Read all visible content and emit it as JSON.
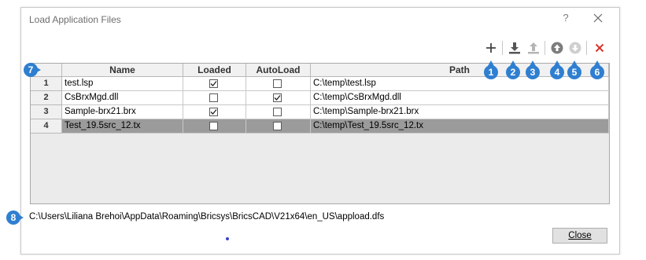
{
  "window": {
    "title": "Load Application Files",
    "help_label": "?"
  },
  "toolbar": {
    "icons": [
      "add-icon",
      "load-icon",
      "unload-icon",
      "move-up-icon",
      "move-down-icon",
      "remove-icon"
    ]
  },
  "table": {
    "columns": [
      "Name",
      "Loaded",
      "AutoLoad",
      "Path"
    ],
    "rows": [
      {
        "num": "1",
        "name": "test.lsp",
        "loaded": true,
        "autoload": false,
        "path": "C:\\temp\\test.lsp"
      },
      {
        "num": "2",
        "name": "CsBrxMgd.dll",
        "loaded": false,
        "autoload": true,
        "path": "C:\\temp\\CsBrxMgd.dll"
      },
      {
        "num": "3",
        "name": "Sample-brx21.brx",
        "loaded": true,
        "autoload": false,
        "path": "C:\\temp\\Sample-brx21.brx"
      },
      {
        "num": "4",
        "name": "Test_19.5src_12.tx",
        "loaded": false,
        "autoload": false,
        "path": "C:\\temp\\Test_19.5src_12.tx"
      }
    ],
    "selected_row": 4
  },
  "callouts": [
    "1",
    "2",
    "3",
    "4",
    "5",
    "6",
    "7",
    "8"
  ],
  "footer": {
    "file_path": "C:\\Users\\Liliana Brehoi\\AppData\\Roaming\\Bricsys\\BricsCAD\\V21x64\\en_US\\appload.dfs",
    "close_label": "Close"
  },
  "colors": {
    "callout": "#2f7fd1",
    "remove": "#d9322b",
    "selected_row": "#9b9b9b"
  }
}
